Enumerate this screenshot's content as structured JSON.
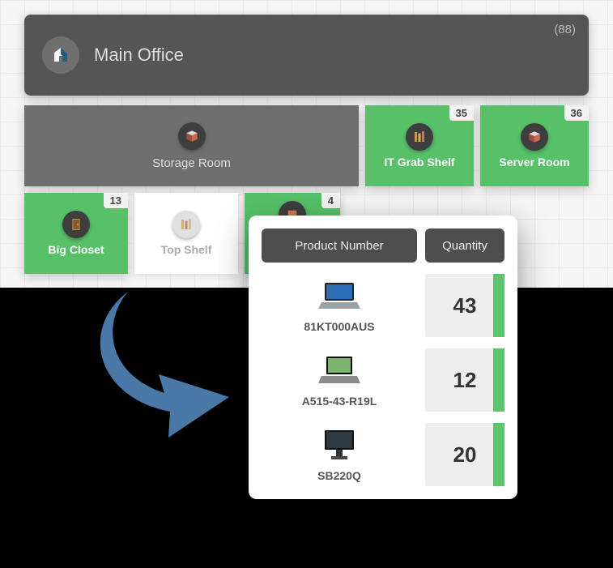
{
  "main": {
    "title": "Main Office",
    "count_display": "(88)"
  },
  "row2": {
    "storage": {
      "title": "Storage Room"
    },
    "itshelf": {
      "title": "IT Grab Shelf",
      "count": "35"
    },
    "server": {
      "title": "Server Room",
      "count": "36"
    }
  },
  "row3": {
    "bigcloset": {
      "title": "Big Closet",
      "count": "13"
    },
    "topshelf": {
      "title": "Top Shelf"
    },
    "cut": {
      "count": "4"
    }
  },
  "popup": {
    "head_product": "Product Number",
    "head_qty": "Quantity",
    "rows": [
      {
        "pn": "81KT000AUS",
        "qty": "43"
      },
      {
        "pn": "A515-43-R19L",
        "qty": "12"
      },
      {
        "pn": "SB220Q",
        "qty": "20"
      }
    ]
  }
}
